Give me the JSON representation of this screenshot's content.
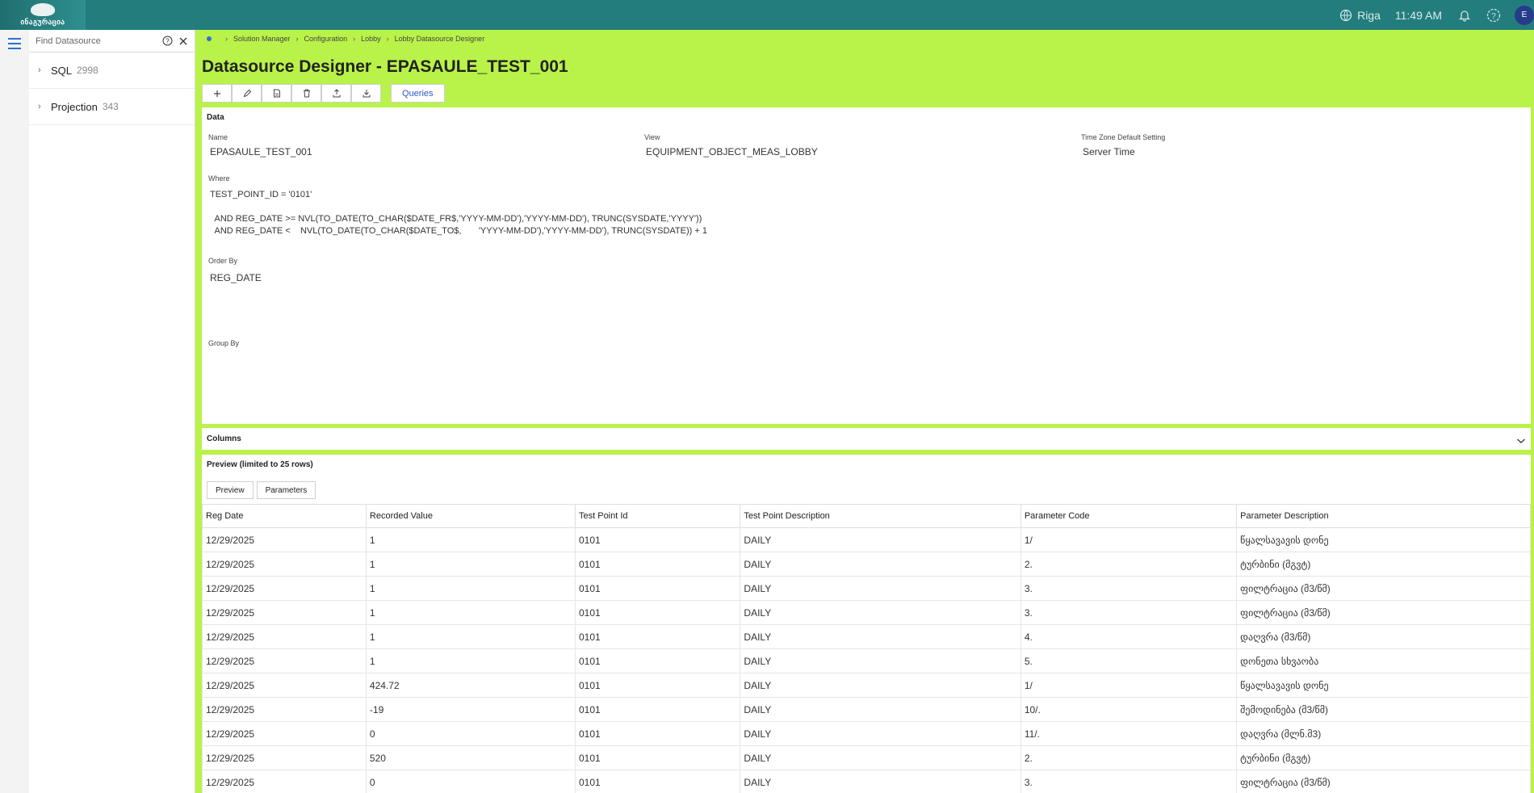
{
  "top": {
    "logo_text": "ინაგურაცია",
    "location": "Riga",
    "time": "11:49 AM",
    "avatar": "E"
  },
  "sidebar": {
    "search_placeholder": "Find Datasource",
    "items": [
      {
        "label": "SQL",
        "count": "2998"
      },
      {
        "label": "Projection",
        "count": "343"
      }
    ]
  },
  "breadcrumb": [
    "Solution Manager",
    "Configuration",
    "Lobby",
    "Lobby Datasource Designer"
  ],
  "page": {
    "title": "Datasource Designer - EPASAULE_TEST_001",
    "queries_label": "Queries"
  },
  "data_card": {
    "heading": "Data",
    "name_label": "Name",
    "name_value": "EPASAULE_TEST_001",
    "view_label": "View",
    "view_value": "EQUIPMENT_OBJECT_MEAS_LOBBY",
    "tz_label": "Time Zone Default Setting",
    "tz_value": "Server Time",
    "where_label": "Where",
    "where_line1": "TEST_POINT_ID = '0101'",
    "where_line2": "  AND REG_DATE >= NVL(TO_DATE(TO_CHAR($DATE_FR$,'YYYY-MM-DD'),'YYYY-MM-DD'), TRUNC(SYSDATE,'YYYY'))",
    "where_line3": "  AND REG_DATE <    NVL(TO_DATE(TO_CHAR($DATE_TO$,       'YYYY-MM-DD'),'YYYY-MM-DD'), TRUNC(SYSDATE)) + 1",
    "orderby_label": "Order By",
    "orderby_value": "REG_DATE",
    "groupby_label": "Group By"
  },
  "columns_card": {
    "heading": "Columns"
  },
  "preview_card": {
    "heading": "Preview (limited to 25 rows)",
    "tabs": [
      "Preview",
      "Parameters"
    ],
    "headers": [
      "Reg Date",
      "Recorded Value",
      "Test Point Id",
      "Test Point Description",
      "Parameter Code",
      "Parameter Description"
    ],
    "rows": [
      [
        "12/29/2025",
        "1",
        "0101",
        "DAILY",
        "1/",
        "წყალსავავის დონე"
      ],
      [
        "12/29/2025",
        "1",
        "0101",
        "DAILY",
        "2.",
        "ტურბინი (მგვტ)"
      ],
      [
        "12/29/2025",
        "1",
        "0101",
        "DAILY",
        "3.",
        "ფილტრაცია (მ3/წმ)"
      ],
      [
        "12/29/2025",
        "1",
        "0101",
        "DAILY",
        "3.",
        "ფილტრაცია (მ3/წმ)"
      ],
      [
        "12/29/2025",
        "1",
        "0101",
        "DAILY",
        "4.",
        "დაღვრა (მ3/წმ)"
      ],
      [
        "12/29/2025",
        "1",
        "0101",
        "DAILY",
        "5.",
        "დონეთა სხვაობა"
      ],
      [
        "12/29/2025",
        "424.72",
        "0101",
        "DAILY",
        "1/",
        "წყალსავავის დონე"
      ],
      [
        "12/29/2025",
        "-19",
        "0101",
        "DAILY",
        "10/.",
        "შემოდინება   (მ3/წმ)"
      ],
      [
        "12/29/2025",
        "0",
        "0101",
        "DAILY",
        "11/.",
        "დაღვრა  (მლნ.მ3)"
      ],
      [
        "12/29/2025",
        "520",
        "0101",
        "DAILY",
        "2.",
        "ტურბინი (მგვტ)"
      ],
      [
        "12/29/2025",
        "0",
        "0101",
        "DAILY",
        "3.",
        "ფილტრაცია (მ3/წმ)"
      ]
    ]
  }
}
